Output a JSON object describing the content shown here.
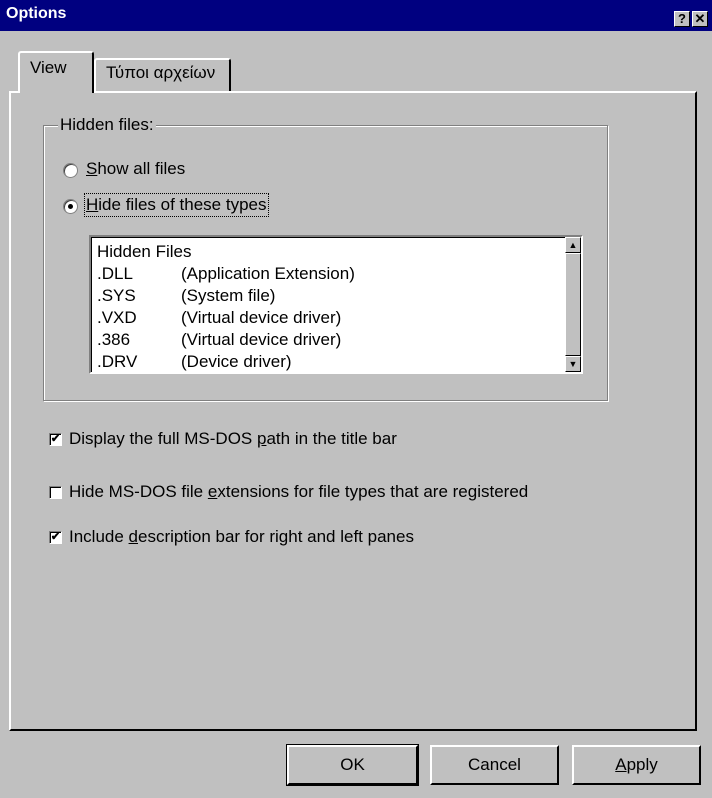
{
  "window": {
    "title": "Options",
    "help_glyph": "?",
    "close_glyph": "✕"
  },
  "tabs": [
    {
      "label": "View",
      "active": true
    },
    {
      "label": "Τύποι αρχείων",
      "active": false
    }
  ],
  "hidden_files": {
    "legend": "Hidden files:",
    "option_show_all": {
      "access": "S",
      "rest": "how all files",
      "selected": false
    },
    "option_hide_types": {
      "access": "H",
      "rest": "ide files of these types",
      "selected": true
    },
    "list_header": "Hidden Files",
    "rows": [
      {
        "ext": ".DLL",
        "desc": "(Application Extension)"
      },
      {
        "ext": ".SYS",
        "desc": "(System file)"
      },
      {
        "ext": ".VXD",
        "desc": "(Virtual device driver)"
      },
      {
        "ext": ".386",
        "desc": "(Virtual device driver)"
      },
      {
        "ext": ".DRV",
        "desc": "(Device driver)"
      }
    ],
    "scroll_up_glyph": "▲",
    "scroll_down_glyph": "▼"
  },
  "checkboxes": {
    "full_path": {
      "pre": "Display the full MS-DOS ",
      "access": "p",
      "post": "ath in the title bar",
      "checked": true
    },
    "hide_ext": {
      "pre": "Hide MS-DOS file ",
      "access": "e",
      "post": "xtensions for file types that are registered",
      "checked": false
    },
    "desc_bar": {
      "pre": "Include ",
      "access": "d",
      "post": "escription bar for right and left panes",
      "checked": true
    },
    "check_glyph": "✔"
  },
  "buttons": {
    "ok": "OK",
    "cancel": "Cancel",
    "apply_access": "A",
    "apply_rest": "pply"
  }
}
